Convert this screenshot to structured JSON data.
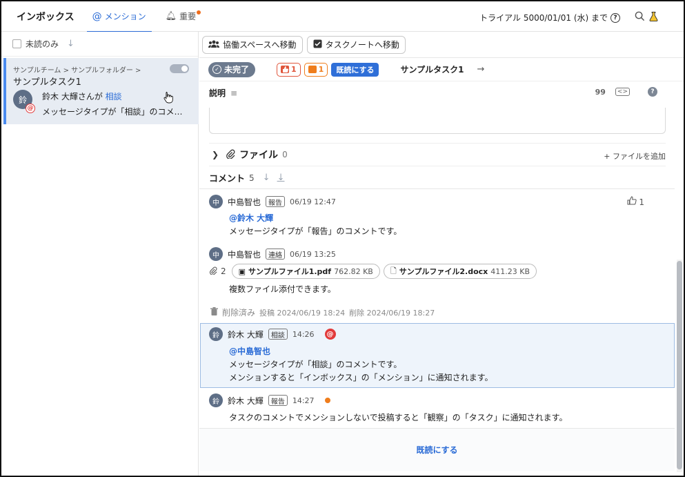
{
  "topbar": {
    "title": "インボックス",
    "tabs": [
      {
        "label": "メンション",
        "active": true,
        "icon": "at-icon"
      },
      {
        "label": "重要",
        "active": false,
        "icon": "bell-icon",
        "badge": true
      }
    ],
    "trial_text": "トライアル 5000/01/01 (水) まで",
    "help_glyph": "?"
  },
  "left": {
    "filter_label": "未読のみ",
    "sort_glyph": "↓",
    "item": {
      "breadcrumb": "サンプルチーム > サンプルフォルダー >",
      "title": "サンプルタスク1",
      "avatar_text": "鈴",
      "line1_prefix": "鈴木 大輝さんが",
      "line1_link": "相談",
      "preview": "メッセージタイプが「相談」のコメ…"
    }
  },
  "toolbar": {
    "collab_label": "協働スペースへ移動",
    "tasknote_label": "タスクノートへ移動"
  },
  "task_header": {
    "status_label": "未完了",
    "like_count": "1",
    "comment_count": "1",
    "mark_read_label": "既読にする",
    "task_name": "サンプルタスク1"
  },
  "description": {
    "label": "説明",
    "quote_glyph": "99",
    "code_glyph": "<>",
    "help_glyph": "?"
  },
  "files": {
    "label": "ファイル",
    "count": "0",
    "add_label": "+ ファイルを追加"
  },
  "comments": {
    "label": "コメント",
    "count": "5",
    "items": [
      {
        "avatar": "中",
        "author": "中島智也",
        "type": "報告",
        "time": "06/19 12:47",
        "mention": "@鈴木 大輝",
        "lines": [
          "メッセージタイプが「報告」のコメントです。"
        ],
        "likes": "1"
      },
      {
        "avatar": "中",
        "author": "中島智也",
        "type": "連絡",
        "time": "06/19 13:25",
        "attach_count": "2",
        "attachments": [
          {
            "name": "サンプルファイル1.pdf",
            "size": "762.82 KB"
          },
          {
            "name": "サンプルファイル2.docx",
            "size": "411.23 KB"
          }
        ],
        "lines": [
          "複数ファイル添付できます。"
        ]
      },
      {
        "deleted_label": "削除済み",
        "posted": "投稿 2024/06/19 18:24",
        "removed": "削除 2024/06/19 18:27"
      },
      {
        "avatar": "鈴",
        "author": "鈴木 大輝",
        "type": "相談",
        "time": "14:26",
        "mention": "@中島智也",
        "lines": [
          "メッセージタイプが「相談」のコメントです。",
          "メンションすると「インボックス」の「メンション」に通知されます。"
        ]
      },
      {
        "avatar": "鈴",
        "author": "鈴木 大輝",
        "type": "報告",
        "time": "14:27",
        "lines": [
          "タスクのコメントでメンションしないで投稿すると「観察」の「タスク」に通知されます。"
        ]
      }
    ]
  },
  "bottom": {
    "mark_read_label": "既読にする"
  },
  "colors": {
    "accent": "#2a6bd6",
    "mention_red": "#e23a3a",
    "unread_orange": "#ef7d1c",
    "selected_bg": "#e7ecf3"
  }
}
